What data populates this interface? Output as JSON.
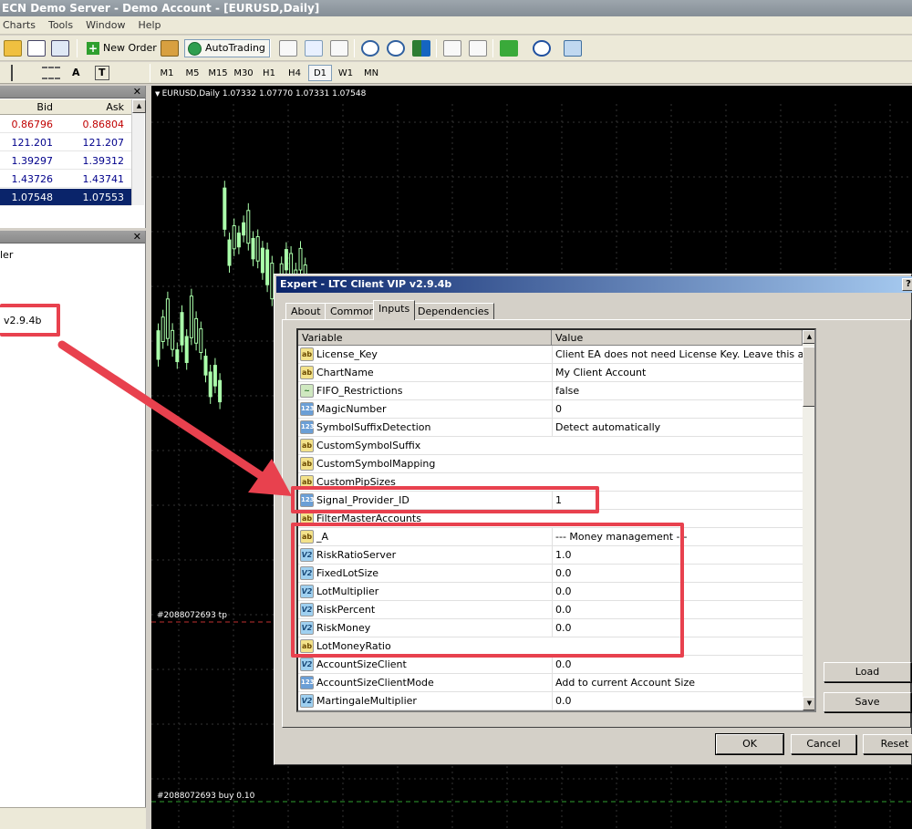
{
  "window": {
    "title": "ECN Demo Server - Demo Account - [EURUSD,Daily]"
  },
  "menu": [
    "Charts",
    "Tools",
    "Window",
    "Help"
  ],
  "toolbar": {
    "new_order": "New Order",
    "autotrading": "AutoTrading"
  },
  "timeframes": [
    "M1",
    "M5",
    "M15",
    "M30",
    "H1",
    "H4",
    "D1",
    "W1",
    "MN"
  ],
  "selected_timeframe": "D1",
  "drawtools": {
    "text": "A",
    "label": "T"
  },
  "market_watch": {
    "col_bid": "Bid",
    "col_ask": "Ask",
    "rows": [
      {
        "bid": "0.86796",
        "ask": "0.86804",
        "color": "#c00000"
      },
      {
        "bid": "121.201",
        "ask": "121.207",
        "color": "#00008b"
      },
      {
        "bid": "1.39297",
        "ask": "1.39312",
        "color": "#00008b"
      },
      {
        "bid": "1.43726",
        "ask": "1.43741",
        "color": "#00008b"
      },
      {
        "bid": "1.07548",
        "ask": "1.07553",
        "color": "#ffffff",
        "selected": true
      }
    ]
  },
  "navigator": {
    "item_partial": "ler",
    "ea_label": "v2.9.4b"
  },
  "chart": {
    "label": "EURUSD,Daily  1.07332 1.07770 1.07331 1.07548",
    "tp_label": "#2088072693 tp",
    "buy_label": "#2088072693 buy 0.10"
  },
  "dialog": {
    "title": "Expert - LTC Client VIP v2.9.4b",
    "help": "?",
    "tabs": [
      "About",
      "Common",
      "Inputs",
      "Dependencies"
    ],
    "active_tab": "Inputs",
    "col_variable": "Variable",
    "col_value": "Value",
    "rows": [
      {
        "icon": "ab",
        "name": "License_Key",
        "value": "Client EA does not need License Key. Leave this as is."
      },
      {
        "icon": "ab",
        "name": "ChartName",
        "value": "My Client Account"
      },
      {
        "icon": "ff",
        "name": "FIFO_Restrictions",
        "value": "false"
      },
      {
        "icon": "123",
        "name": "MagicNumber",
        "value": "0"
      },
      {
        "icon": "123",
        "name": "SymbolSuffixDetection",
        "value": "Detect automatically"
      },
      {
        "icon": "ab",
        "name": "CustomSymbolSuffix",
        "value": ""
      },
      {
        "icon": "ab",
        "name": "CustomSymbolMapping",
        "value": ""
      },
      {
        "icon": "ab",
        "name": "CustomPipSizes",
        "value": ""
      },
      {
        "icon": "123",
        "name": "Signal_Provider_ID",
        "value": "1"
      },
      {
        "icon": "ab",
        "name": "FilterMasterAccounts",
        "value": ""
      },
      {
        "icon": "ab",
        "name": "_A",
        "value": "--- Money management ---"
      },
      {
        "icon": "va",
        "name": "RiskRatioServer",
        "value": "1.0"
      },
      {
        "icon": "va",
        "name": "FixedLotSize",
        "value": "0.0"
      },
      {
        "icon": "va",
        "name": "LotMultiplier",
        "value": "0.0"
      },
      {
        "icon": "va",
        "name": "RiskPercent",
        "value": "0.0"
      },
      {
        "icon": "va",
        "name": "RiskMoney",
        "value": "0.0"
      },
      {
        "icon": "ab",
        "name": "LotMoneyRatio",
        "value": ""
      },
      {
        "icon": "va",
        "name": "AccountSizeClient",
        "value": "0.0"
      },
      {
        "icon": "123",
        "name": "AccountSizeClientMode",
        "value": "Add to current Account Size"
      },
      {
        "icon": "va",
        "name": "MartingaleMultiplier",
        "value": "0.0"
      }
    ],
    "buttons": {
      "load": "Load",
      "save": "Save",
      "ok": "OK",
      "cancel": "Cancel",
      "reset": "Reset"
    }
  },
  "icon_glyphs": {
    "ab": "ab",
    "123": "123",
    "va": "V2",
    "ff": "~"
  },
  "colors": {
    "annotation": "#e8414e",
    "chart_bg": "#000000",
    "candle": "#aaffaa",
    "selection": "#0a246a"
  }
}
